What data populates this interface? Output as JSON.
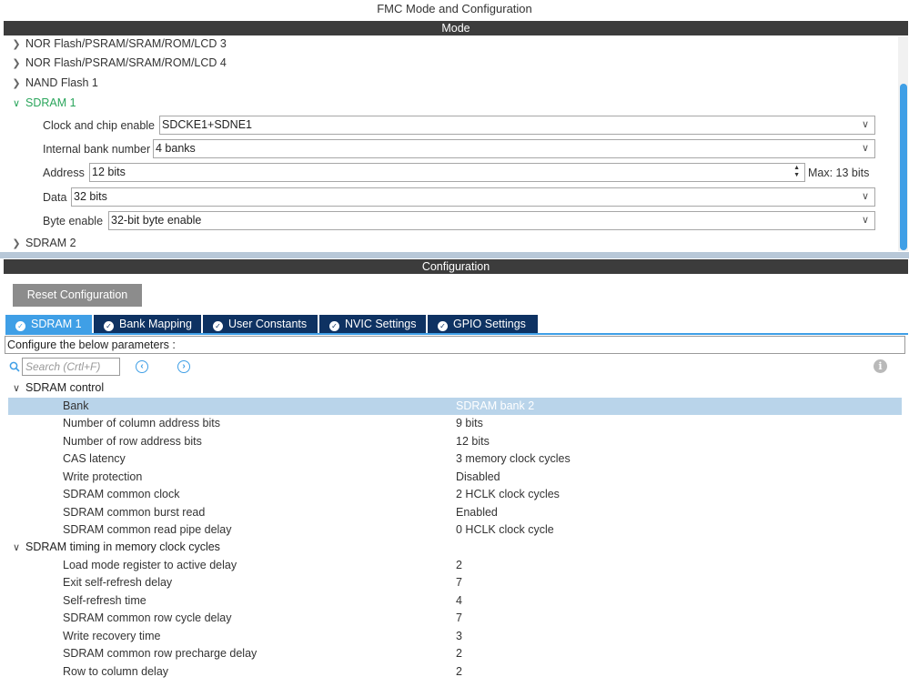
{
  "window": {
    "title": "FMC Mode and Configuration"
  },
  "mode": {
    "header": "Mode",
    "tree": [
      {
        "label": "NOR Flash/PSRAM/SRAM/ROM/LCD 3",
        "expanded": false
      },
      {
        "label": "NOR Flash/PSRAM/SRAM/ROM/LCD 4",
        "expanded": false
      },
      {
        "label": "NAND Flash 1",
        "expanded": false
      },
      {
        "label": "SDRAM 1",
        "expanded": true
      },
      {
        "label": "SDRAM 2",
        "expanded": false
      }
    ],
    "fields": {
      "clock": {
        "label": "Clock and chip enable",
        "value": "SDCKE1+SDNE1"
      },
      "bank_number": {
        "label": "Internal bank number",
        "value": "4 banks"
      },
      "address": {
        "label": "Address",
        "value": "12 bits",
        "max": "Max: 13 bits"
      },
      "data": {
        "label": "Data",
        "value": "32 bits"
      },
      "byte_enable": {
        "label": "Byte enable",
        "value": "32-bit byte enable"
      }
    }
  },
  "config": {
    "header": "Configuration",
    "reset_label": "Reset Configuration",
    "tabs": [
      {
        "label": "SDRAM 1",
        "active": true
      },
      {
        "label": "Bank Mapping",
        "active": false
      },
      {
        "label": "User Constants",
        "active": false
      },
      {
        "label": "NVIC Settings",
        "active": false
      },
      {
        "label": "GPIO Settings",
        "active": false
      }
    ],
    "hint": "Configure the below parameters :",
    "search_placeholder": "Search (Crtl+F)",
    "groups": [
      {
        "label": "SDRAM control",
        "params": [
          {
            "name": "Bank",
            "value": "SDRAM bank 2"
          },
          {
            "name": "Number of column address bits",
            "value": "9 bits"
          },
          {
            "name": "Number of row address bits",
            "value": "12 bits"
          },
          {
            "name": "CAS latency",
            "value": "3 memory clock cycles"
          },
          {
            "name": "Write protection",
            "value": "Disabled"
          },
          {
            "name": "SDRAM common clock",
            "value": "2 HCLK clock cycles"
          },
          {
            "name": "SDRAM common burst read",
            "value": "Enabled"
          },
          {
            "name": "SDRAM common read pipe delay",
            "value": "0 HCLK clock cycle"
          }
        ]
      },
      {
        "label": "SDRAM timing in memory clock cycles",
        "params": [
          {
            "name": "Load mode register to active delay",
            "value": "2"
          },
          {
            "name": "Exit self-refresh delay",
            "value": "7"
          },
          {
            "name": "Self-refresh time",
            "value": "4"
          },
          {
            "name": "SDRAM common row cycle delay",
            "value": "7"
          },
          {
            "name": "Write recovery time",
            "value": "3"
          },
          {
            "name": "SDRAM common row precharge delay",
            "value": "2"
          },
          {
            "name": "Row to column delay",
            "value": "2"
          }
        ]
      }
    ]
  },
  "colors": {
    "accent": "#3f9fe6",
    "tab_bg": "#0e3262",
    "header_bg": "#3c3c3c",
    "active_tree": "#2aa55b",
    "selected_row": "#b9d4ea"
  }
}
